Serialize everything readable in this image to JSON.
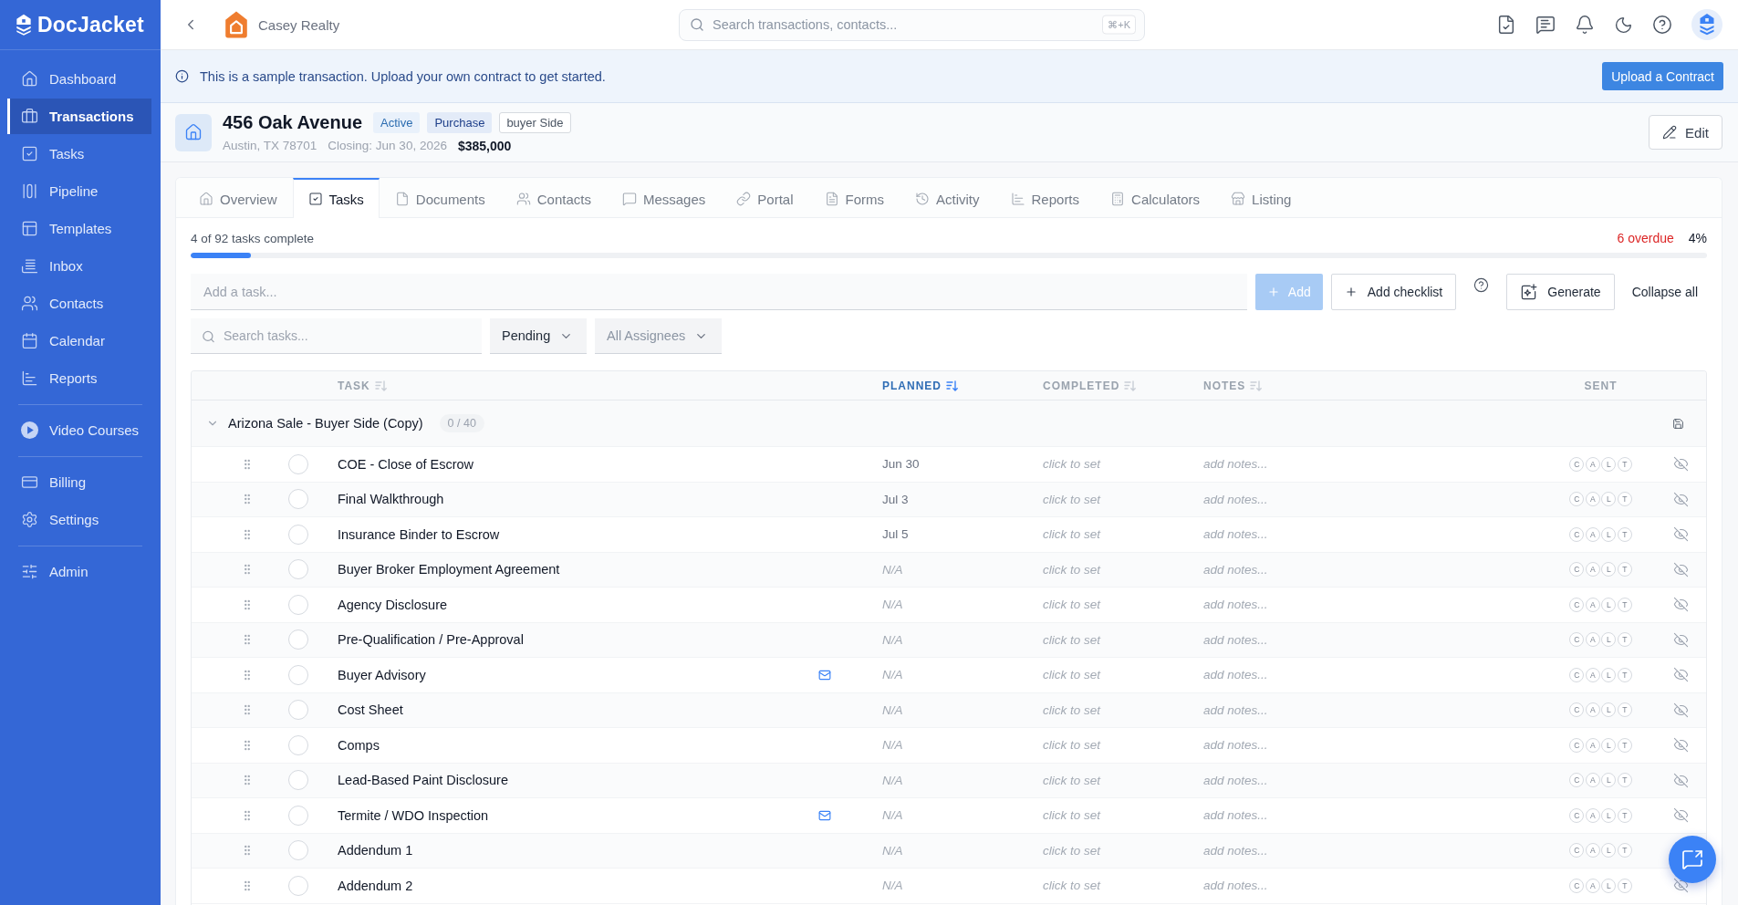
{
  "sidebar": {
    "brand": "DocJacket",
    "groups": [
      {
        "items": [
          {
            "label": "Dashboard",
            "selected": false
          },
          {
            "label": "Transactions",
            "selected": true
          },
          {
            "label": "Tasks",
            "selected": false
          },
          {
            "label": "Pipeline",
            "selected": false
          },
          {
            "label": "Templates",
            "selected": false
          },
          {
            "label": "Inbox",
            "selected": false
          },
          {
            "label": "Contacts",
            "selected": false
          },
          {
            "label": "Calendar",
            "selected": false
          },
          {
            "label": "Reports",
            "selected": false
          }
        ]
      },
      {
        "items": [
          {
            "label": "Video Courses",
            "selected": false
          }
        ]
      },
      {
        "items": [
          {
            "label": "Billing",
            "selected": false
          },
          {
            "label": "Settings",
            "selected": false
          }
        ]
      },
      {
        "items": [
          {
            "label": "Admin",
            "selected": false
          }
        ]
      }
    ]
  },
  "topbar": {
    "workspace": "Casey Realty",
    "search": {
      "placeholder": "Search transactions, contacts...",
      "shortcut": "⌘+K"
    }
  },
  "banner": {
    "message": "This is a sample transaction. Upload your own contract to get started.",
    "button": "Upload a Contract"
  },
  "transaction": {
    "title": "456 Oak Avenue",
    "badges": [
      {
        "label": "Active",
        "kind": "status"
      },
      {
        "label": "Purchase",
        "kind": "type"
      },
      {
        "label": "buyer Side",
        "kind": "outline"
      }
    ],
    "address": "Austin, TX 78701",
    "closing": "Closing: Jun 30, 2026",
    "price": "$385,000",
    "edit_button": "Edit"
  },
  "tabs": [
    {
      "label": "Overview",
      "selected": false
    },
    {
      "label": "Tasks",
      "selected": true
    },
    {
      "label": "Documents",
      "selected": false
    },
    {
      "label": "Contacts",
      "selected": false
    },
    {
      "label": "Messages",
      "selected": false
    },
    {
      "label": "Portal",
      "selected": false
    },
    {
      "label": "Forms",
      "selected": false
    },
    {
      "label": "Activity",
      "selected": false
    },
    {
      "label": "Reports",
      "selected": false
    },
    {
      "label": "Calculators",
      "selected": false
    },
    {
      "label": "Listing",
      "selected": false
    }
  ],
  "progress": {
    "summary": "4 of 92 tasks complete",
    "level": 0.04,
    "overdue": "6 overdue",
    "percent": "4%"
  },
  "task_entry": {
    "placeholder": "Add a task...",
    "add_button": {
      "label": "Add",
      "disabled": true
    },
    "checklist_button": "Add checklist",
    "generate_button": "Generate",
    "collapse_button": "Collapse all"
  },
  "filters": {
    "search": {
      "placeholder": "Search tasks..."
    },
    "status": {
      "value": "Pending"
    },
    "assignee": {
      "placeholder": "All Assignees"
    }
  },
  "table": {
    "columns": [
      {
        "label": "TASK",
        "sortable": true,
        "sorted": false
      },
      {
        "label": "PLANNED",
        "sortable": true,
        "sorted": true
      },
      {
        "label": "COMPLETED",
        "sortable": true,
        "sorted": false
      },
      {
        "label": "NOTES",
        "sortable": true,
        "sorted": false
      },
      {
        "label": "SENT",
        "sortable": false,
        "sorted": false
      }
    ],
    "group": {
      "title": "Arizona Sale - Buyer Side (Copy)",
      "count": "0 / 40",
      "expanded": true
    },
    "rows": [
      {
        "title": "COE - Close of Escrow",
        "done": false,
        "email": false,
        "planned": {
          "kind": "date",
          "text": "Jun 30"
        },
        "completed": {
          "placeholder": "click to set"
        },
        "notes": {
          "placeholder": "add notes..."
        },
        "sent": [
          "C",
          "A",
          "L",
          "T"
        ],
        "hidden": true
      },
      {
        "title": "Final Walkthrough",
        "done": false,
        "email": false,
        "planned": {
          "kind": "date",
          "text": "Jul 3"
        },
        "completed": {
          "placeholder": "click to set"
        },
        "notes": {
          "placeholder": "add notes..."
        },
        "sent": [
          "C",
          "A",
          "L",
          "T"
        ],
        "hidden": true
      },
      {
        "title": "Insurance Binder to Escrow",
        "done": false,
        "email": false,
        "planned": {
          "kind": "date",
          "text": "Jul 5"
        },
        "completed": {
          "placeholder": "click to set"
        },
        "notes": {
          "placeholder": "add notes..."
        },
        "sent": [
          "C",
          "A",
          "L",
          "T"
        ],
        "hidden": true
      },
      {
        "title": "Buyer Broker Employment Agreement",
        "done": false,
        "email": false,
        "planned": {
          "kind": "empty",
          "text": "N/A"
        },
        "completed": {
          "placeholder": "click to set"
        },
        "notes": {
          "placeholder": "add notes..."
        },
        "sent": [
          "C",
          "A",
          "L",
          "T"
        ],
        "hidden": true
      },
      {
        "title": "Agency Disclosure",
        "done": false,
        "email": false,
        "planned": {
          "kind": "empty",
          "text": "N/A"
        },
        "completed": {
          "placeholder": "click to set"
        },
        "notes": {
          "placeholder": "add notes..."
        },
        "sent": [
          "C",
          "A",
          "L",
          "T"
        ],
        "hidden": true
      },
      {
        "title": "Pre-Qualification / Pre-Approval",
        "done": false,
        "email": false,
        "planned": {
          "kind": "empty",
          "text": "N/A"
        },
        "completed": {
          "placeholder": "click to set"
        },
        "notes": {
          "placeholder": "add notes..."
        },
        "sent": [
          "C",
          "A",
          "L",
          "T"
        ],
        "hidden": true
      },
      {
        "title": "Buyer Advisory",
        "done": false,
        "email": true,
        "planned": {
          "kind": "empty",
          "text": "N/A"
        },
        "completed": {
          "placeholder": "click to set"
        },
        "notes": {
          "placeholder": "add notes..."
        },
        "sent": [
          "C",
          "A",
          "L",
          "T"
        ],
        "hidden": true
      },
      {
        "title": "Cost Sheet",
        "done": false,
        "email": false,
        "planned": {
          "kind": "empty",
          "text": "N/A"
        },
        "completed": {
          "placeholder": "click to set"
        },
        "notes": {
          "placeholder": "add notes..."
        },
        "sent": [
          "C",
          "A",
          "L",
          "T"
        ],
        "hidden": true
      },
      {
        "title": "Comps",
        "done": false,
        "email": false,
        "planned": {
          "kind": "empty",
          "text": "N/A"
        },
        "completed": {
          "placeholder": "click to set"
        },
        "notes": {
          "placeholder": "add notes..."
        },
        "sent": [
          "C",
          "A",
          "L",
          "T"
        ],
        "hidden": true
      },
      {
        "title": "Lead-Based Paint Disclosure",
        "done": false,
        "email": false,
        "planned": {
          "kind": "empty",
          "text": "N/A"
        },
        "completed": {
          "placeholder": "click to set"
        },
        "notes": {
          "placeholder": "add notes..."
        },
        "sent": [
          "C",
          "A",
          "L",
          "T"
        ],
        "hidden": true
      },
      {
        "title": "Termite / WDO Inspection",
        "done": false,
        "email": true,
        "planned": {
          "kind": "empty",
          "text": "N/A"
        },
        "completed": {
          "placeholder": "click to set"
        },
        "notes": {
          "placeholder": "add notes..."
        },
        "sent": [
          "C",
          "A",
          "L",
          "T"
        ],
        "hidden": true
      },
      {
        "title": "Addendum 1",
        "done": false,
        "email": false,
        "planned": {
          "kind": "empty",
          "text": "N/A"
        },
        "completed": {
          "placeholder": "click to set"
        },
        "notes": {
          "placeholder": "add notes..."
        },
        "sent": [
          "C",
          "A",
          "L",
          "T"
        ]
      },
      {
        "title": "Addendum 2",
        "done": false,
        "email": false,
        "planned": {
          "kind": "empty",
          "text": "N/A"
        },
        "completed": {
          "placeholder": "click to set"
        },
        "notes": {
          "placeholder": "add notes..."
        },
        "sent": [
          "C",
          "A",
          "L",
          "T"
        ],
        "hidden": true
      }
    ]
  }
}
